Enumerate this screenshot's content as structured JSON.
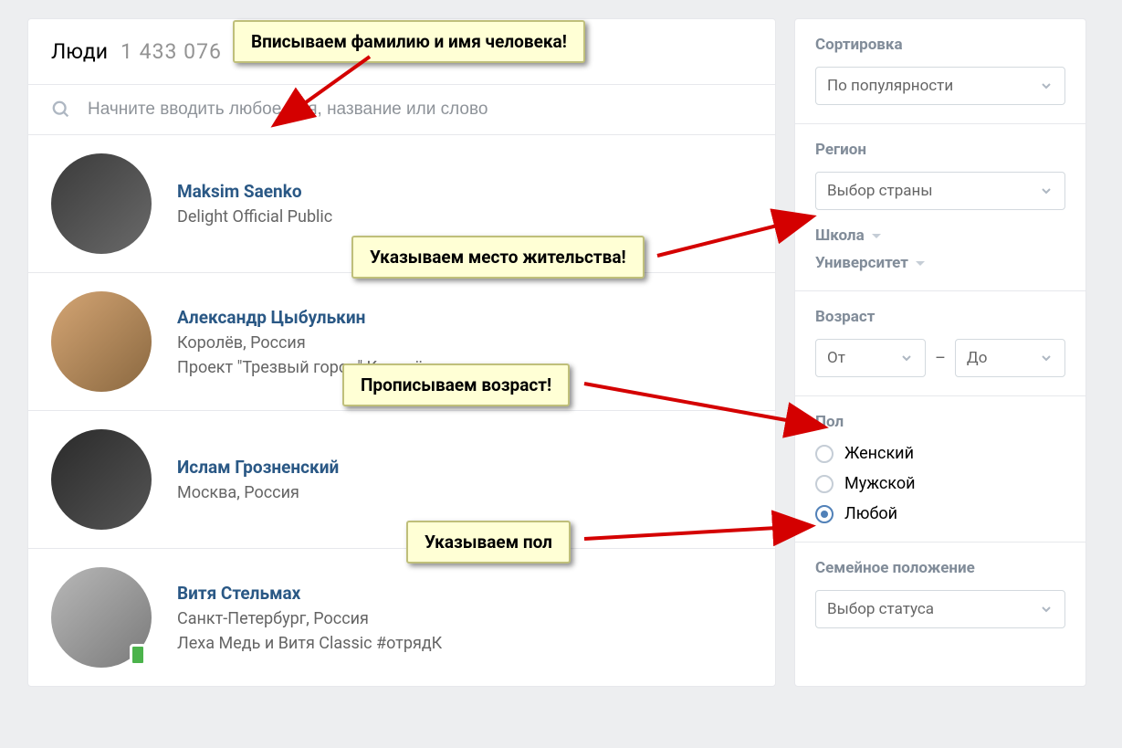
{
  "header": {
    "title": "Люди",
    "count": "1 433 076"
  },
  "search": {
    "placeholder": "Начните вводить любое имя, название или слово"
  },
  "results": [
    {
      "name": "Maksim Saenko",
      "meta1": "Delight Official Public",
      "meta2": "",
      "online": false
    },
    {
      "name": "Александр Цыбулькин",
      "meta1": "Королёв, Россия",
      "meta2": "Проект \"Трезвый город\"   Королёв",
      "online": false
    },
    {
      "name": "Ислам Грозненский",
      "meta1": "Москва, Россия",
      "meta2": "",
      "online": false
    },
    {
      "name": "Витя Стельмах",
      "meta1": "Санкт-Петербург, Россия",
      "meta2": "Леха Медь и Витя Сlassic #отрядК",
      "online": true
    }
  ],
  "sidebar": {
    "sort_label": "Сортировка",
    "sort_value": "По популярности",
    "region_label": "Регион",
    "region_value": "Выбор страны",
    "school_label": "Школа",
    "university_label": "Университет",
    "age_label": "Возраст",
    "age_from": "От",
    "age_to": "До",
    "gender_label": "Пол",
    "gender_options": [
      "Женский",
      "Мужской",
      "Любой"
    ],
    "gender_selected": 2,
    "marital_label": "Семейное положение",
    "marital_value": "Выбор статуса"
  },
  "annotations": {
    "a1": "Вписываем фамилию и имя человека!",
    "a2": "Указываем место жительства!",
    "a3": "Прописываем возраст!",
    "a4": "Указываем пол"
  }
}
